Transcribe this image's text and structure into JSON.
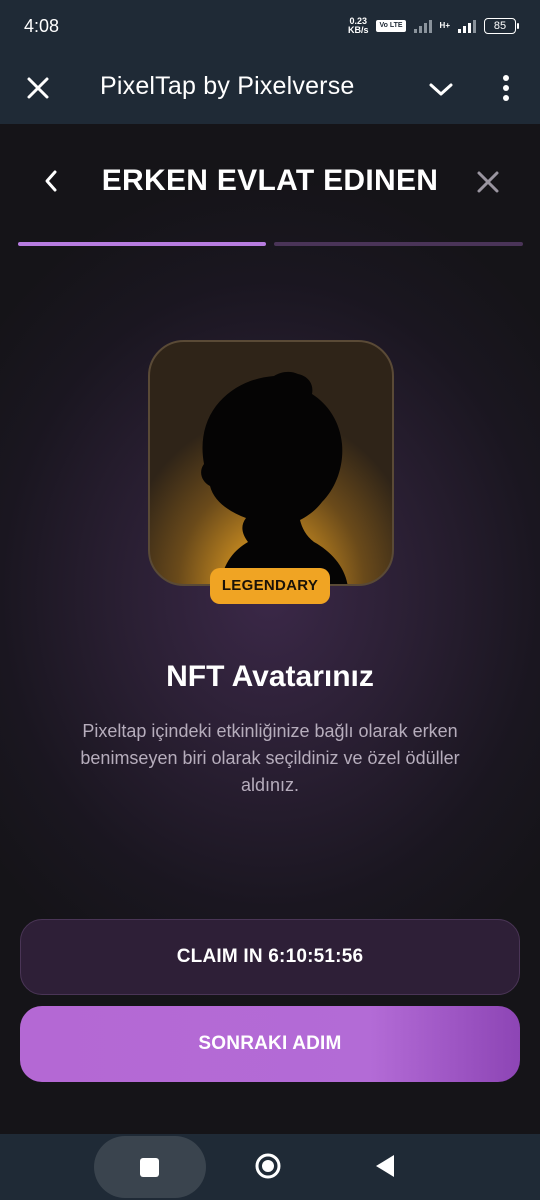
{
  "status_bar": {
    "time": "4:08",
    "net_speed_value": "0.23",
    "net_speed_unit": "KB/s",
    "volte": "Vo LTE",
    "net_type": "H+",
    "battery": "85"
  },
  "app_bar": {
    "title": "PixelTap by Pixelverse"
  },
  "header": {
    "title": "ERKEN EVLAT EDINEN"
  },
  "progress": {
    "current_step": 1,
    "total_steps": 2
  },
  "avatar": {
    "rarity_badge": "LEGENDARY"
  },
  "main": {
    "title": "NFT Avatarınız",
    "description": "Pixeltap içindeki etkinliğinize bağlı olarak erken benimseyen biri olarak seçildiniz ve özel ödüller aldınız."
  },
  "buttons": {
    "claim_label": "CLAIM IN 6:10:51:56",
    "next_label": "SONRAKI ADIM"
  },
  "colors": {
    "accent_purple": "#b77ce0",
    "badge_orange": "#f0a423",
    "system_bar": "#1f2a36"
  }
}
